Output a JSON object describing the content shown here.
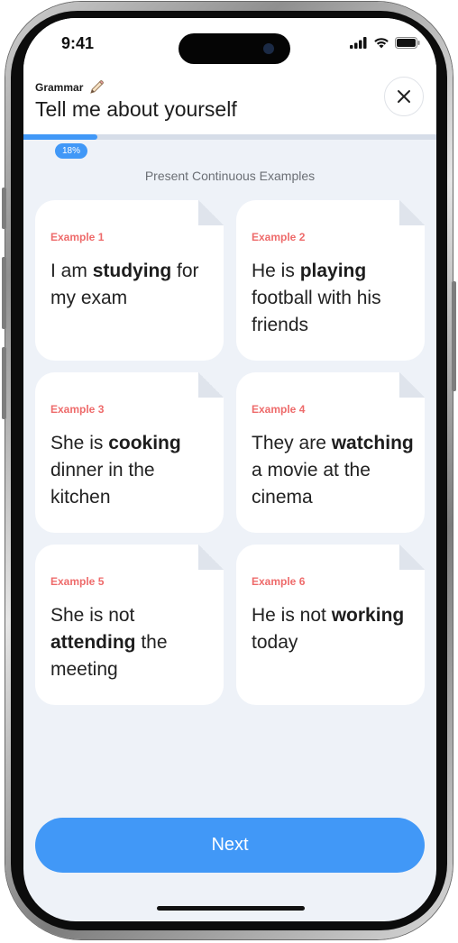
{
  "status_bar": {
    "time": "9:41"
  },
  "header": {
    "category": "Grammar",
    "title": "Tell me about yourself",
    "close_icon": "close-icon",
    "category_icon": "pencil-icon"
  },
  "progress": {
    "value": 0.18,
    "label": "18%"
  },
  "section": {
    "heading": "Present Continuous Examples"
  },
  "examples": [
    {
      "label": "Example 1",
      "before": "I am ",
      "bold": "studying",
      "after": " for my exam"
    },
    {
      "label": "Example 2",
      "before": "He is ",
      "bold": "playing",
      "after": " football with his friends"
    },
    {
      "label": "Example 3",
      "before": "She is ",
      "bold": "cooking",
      "after": " dinner in the kitchen"
    },
    {
      "label": "Example 4",
      "before": "They are ",
      "bold": "watching",
      "after": " a movie at the cinema"
    },
    {
      "label": "Example 5",
      "before": "She is not ",
      "bold": "attending",
      "after": " the meeting"
    },
    {
      "label": "Example 6",
      "before": "He is not ",
      "bold": "working",
      "after": " today"
    }
  ],
  "footer": {
    "next_label": "Next"
  },
  "colors": {
    "accent": "#4198f7",
    "example_label": "#ee6b6b",
    "background": "#eef2f8"
  }
}
